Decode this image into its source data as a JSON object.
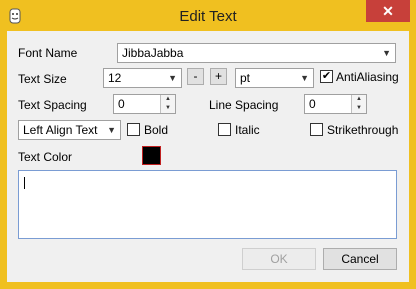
{
  "window": {
    "title": "Edit Text",
    "close_glyph": "✕"
  },
  "font": {
    "label": "Font Name",
    "value": "JibbaJabba"
  },
  "size": {
    "label": "Text Size",
    "value": "12",
    "minus": "-",
    "plus": "+",
    "unit": "pt",
    "antialias_label": "AntiAliasing",
    "antialias_checked": true
  },
  "spacing": {
    "text_label": "Text Spacing",
    "text_value": "0",
    "line_label": "Line Spacing",
    "line_value": "0"
  },
  "align": {
    "value": "Left Align Text"
  },
  "style": {
    "bold": "Bold",
    "italic": "Italic",
    "strike": "Strikethrough"
  },
  "color": {
    "label": "Text Color",
    "value": "#000000"
  },
  "buttons": {
    "ok": "OK",
    "cancel": "Cancel"
  },
  "icons": {
    "dropdown": "chevron-down-icon",
    "spin_up": "▲",
    "spin_down": "▼",
    "check": "✔"
  }
}
